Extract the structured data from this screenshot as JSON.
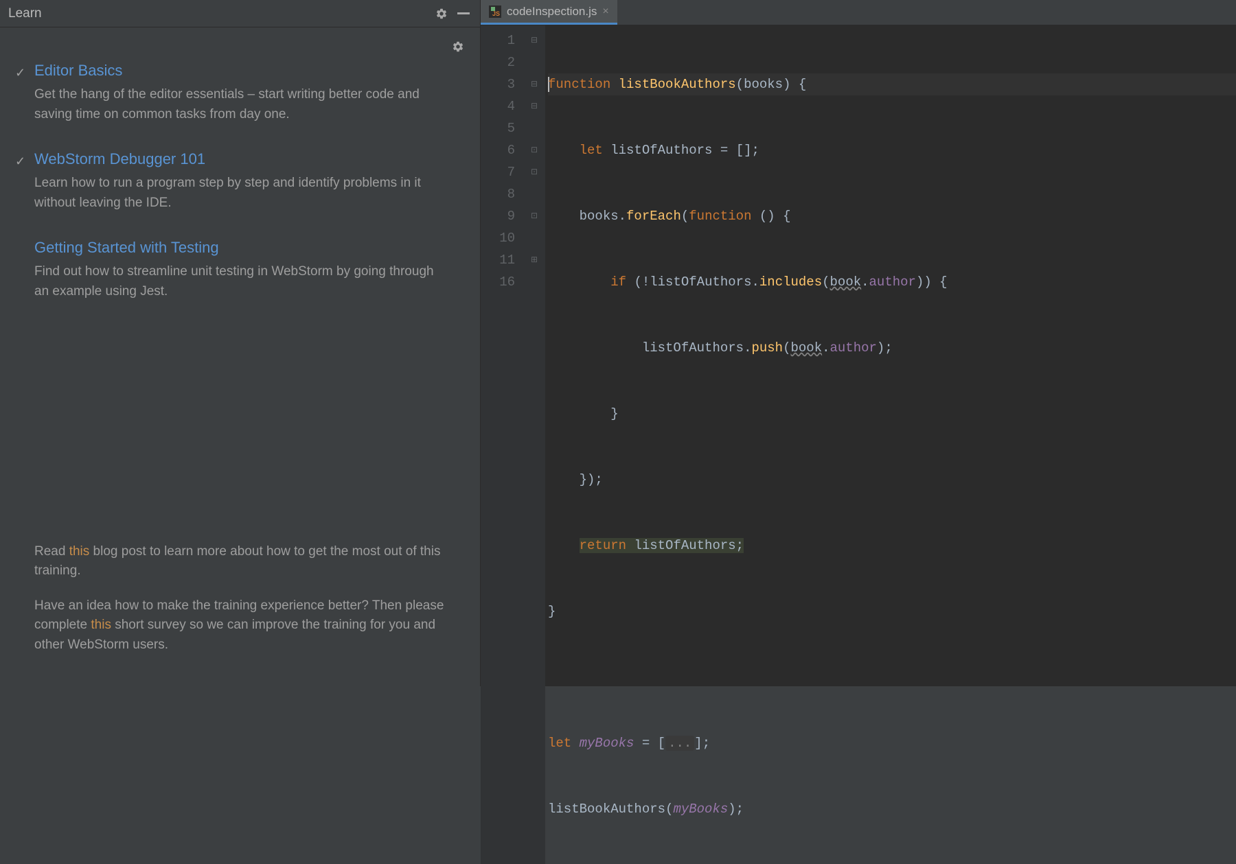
{
  "learn": {
    "title": "Learn",
    "lessons": [
      {
        "completed": true,
        "title": "Editor Basics",
        "desc": "Get the hang of the editor essentials – start writing better code and saving time on common tasks from day one."
      },
      {
        "completed": true,
        "title": "WebStorm Debugger 101",
        "desc": "Learn how to run a program step by step and identify problems in it without leaving the IDE."
      },
      {
        "completed": false,
        "title": "Getting Started with Testing",
        "desc": "Find out how to streamline unit testing in WebStorm by going through an example using Jest."
      }
    ],
    "footer": {
      "p1_pre": "Read ",
      "p1_link": "this",
      "p1_post": " blog post to learn more about how to get the most out of this training.",
      "p2_pre": "Have an idea how to make the training experience better? Then please complete ",
      "p2_link": "this",
      "p2_post": " short survey so we can improve the training for you and other WebStorm users."
    }
  },
  "editor": {
    "tab_name": "codeInspection.js",
    "line_numbers": [
      "1",
      "2",
      "3",
      "4",
      "5",
      "6",
      "7",
      "8",
      "9",
      "10",
      "11",
      "16"
    ],
    "code": {
      "l1": {
        "kw": "function",
        "fn": "listBookAuthors",
        "param": "books"
      },
      "l2": {
        "kw": "let",
        "var": "listOfAuthors",
        "init": "[]"
      },
      "l3": {
        "obj": "books",
        "method": "forEach",
        "kw": "function"
      },
      "l4": {
        "kw": "if",
        "neg": "!",
        "obj": "listOfAuthors",
        "method": "includes",
        "arg_obj": "book",
        "arg_prop": "author"
      },
      "l5": {
        "obj": "listOfAuthors",
        "method": "push",
        "arg_obj": "book",
        "arg_prop": "author"
      },
      "l6": {
        "brace": "}"
      },
      "l7": {
        "close": "});"
      },
      "l8": {
        "kw": "return",
        "var": "listOfAuthors"
      },
      "l9": {
        "brace": "}"
      },
      "l11": {
        "kw": "let",
        "var": "myBooks",
        "fold": "..."
      },
      "l16": {
        "fn": "listBookAuthors",
        "arg": "myBooks"
      }
    }
  }
}
